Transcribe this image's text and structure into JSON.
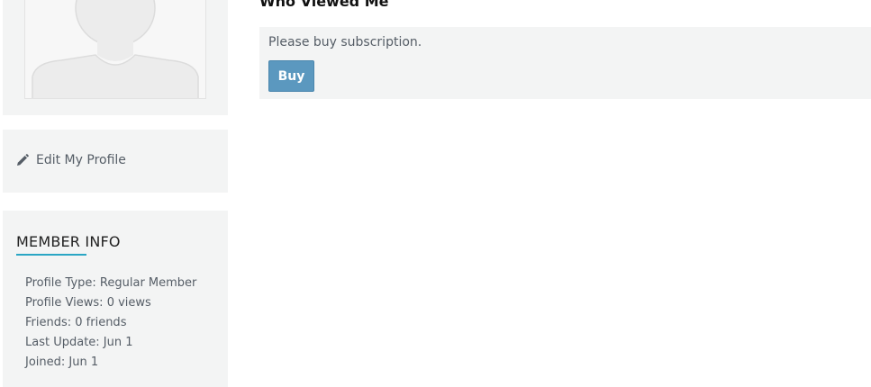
{
  "main": {
    "heading": "Who Viewed Me",
    "notice_text": "Please buy subscription.",
    "buy_label": "Buy"
  },
  "sidebar": {
    "edit_profile_label": "Edit My Profile",
    "member_info": {
      "title": "MEMBER INFO",
      "items": [
        "Profile Type: Regular Member",
        "Profile Views: 0 views",
        "Friends: 0 friends",
        "Last Update: Jun 1",
        "Joined: Jun 1"
      ]
    }
  },
  "colors": {
    "card_bg": "#f3f4f4",
    "accent": "#2aa6c4",
    "button": "#5b98bf"
  },
  "icons": {
    "avatar": "default-avatar-silhouette",
    "edit": "pencil-icon"
  }
}
